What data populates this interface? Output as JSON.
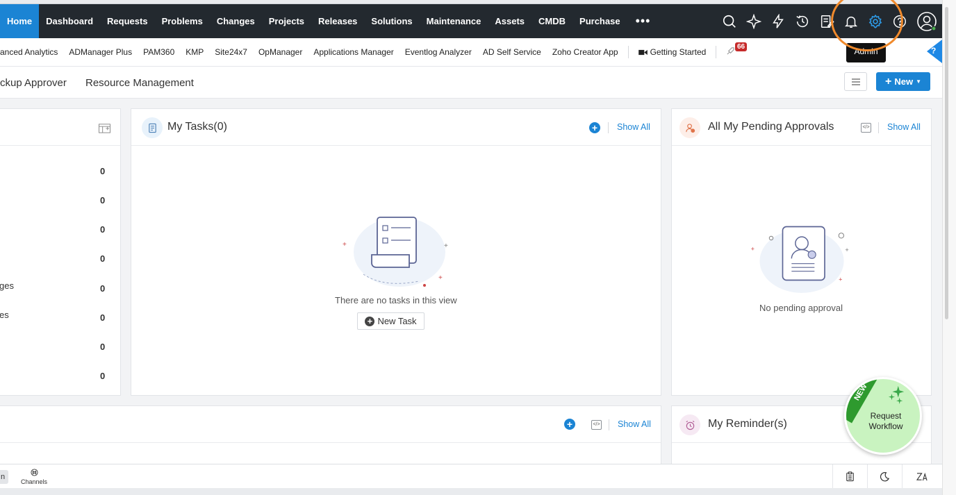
{
  "topnav": {
    "items": [
      "Home",
      "Dashboard",
      "Requests",
      "Problems",
      "Changes",
      "Projects",
      "Releases",
      "Solutions",
      "Maintenance",
      "Assets",
      "CMDB",
      "Purchase"
    ],
    "more": "•••",
    "icons": [
      "search-icon",
      "magic-icon",
      "lightning-icon",
      "history-icon",
      "notes-icon",
      "bell-icon",
      "gear-icon",
      "help-icon",
      "user-icon"
    ]
  },
  "quicklinks": {
    "items": [
      "anced Analytics",
      "ADManager Plus",
      "PAM360",
      "KMP",
      "Site24x7",
      "OpManager",
      "Applications Manager",
      "Eventlog Analyzer",
      "AD Self Service",
      "Zoho Creator App"
    ],
    "getting_started": "Getting Started",
    "badge": "66",
    "help": "?"
  },
  "tabs": {
    "items": [
      "ckup Approver",
      "Resource Management"
    ],
    "new_label": "New"
  },
  "left_card": {
    "rows": [
      {
        "label": "",
        "value": "0"
      },
      {
        "label": "",
        "value": "0"
      },
      {
        "label": "",
        "value": "0"
      },
      {
        "label": "",
        "value": "0"
      },
      {
        "label": "ges",
        "value": "0"
      },
      {
        "label": "es",
        "value": "0"
      },
      {
        "label": "",
        "value": "0"
      },
      {
        "label": "",
        "value": "0"
      }
    ]
  },
  "tasks_card": {
    "title": "My Tasks(0)",
    "show_all": "Show All",
    "empty": "There are no tasks in this view",
    "new_task": "New Task"
  },
  "approvals_card": {
    "title": "All My Pending Approvals",
    "show_all": "Show All",
    "empty": "No pending approval"
  },
  "bottom_left_card": {
    "show_all": "Show All"
  },
  "reminders_card": {
    "title": "My Reminder(s)"
  },
  "workflow_badge": {
    "ribbon": "NEW",
    "text": "Request Workflow"
  },
  "tooltip": {
    "text": "Admin"
  },
  "bottombar": {
    "left_tab": "n",
    "channels": "Channels"
  },
  "colors": {
    "accent": "#1b84d4",
    "nav_bg": "#23292f",
    "highlight": "#f08a2c",
    "badge_red": "#c62a2a",
    "workflow_green": "#2e9a2e"
  }
}
